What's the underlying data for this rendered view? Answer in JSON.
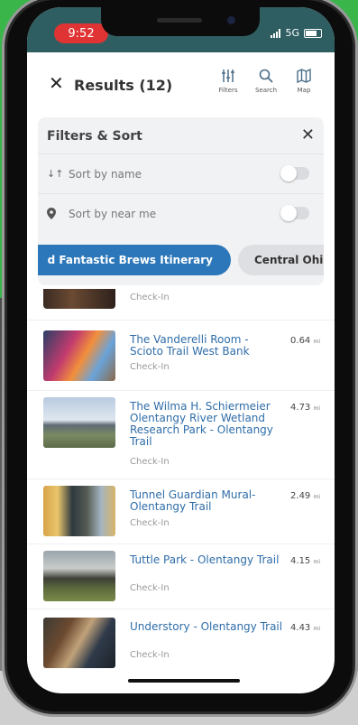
{
  "status_bar": {
    "time": "9:52",
    "network": "5G"
  },
  "header": {
    "close_icon": "close-icon",
    "title": "Results (12)",
    "actions": [
      {
        "label": "Filters",
        "icon": "sliders-icon"
      },
      {
        "label": "Search",
        "icon": "search-icon"
      },
      {
        "label": "Map",
        "icon": "map-icon"
      }
    ]
  },
  "filters": {
    "title": "Filters & Sort",
    "close_icon": "close-icon",
    "sort_options": [
      {
        "label": "Sort by name",
        "icon": "sort-alpha-icon",
        "enabled": false
      },
      {
        "label": "Sort by near me",
        "icon": "location-pin-icon",
        "enabled": false
      }
    ],
    "chips": [
      {
        "label": "d Fantastic Brews Itinerary",
        "selected": true
      },
      {
        "label": "Central Ohio",
        "selected": false
      }
    ]
  },
  "results": {
    "partial_item": {
      "subtitle": "Check-In"
    },
    "items": [
      {
        "title": "The Vanderelli Room - Scioto Trail West Bank",
        "subtitle": "Check-In",
        "distance": "0.64",
        "unit": "mi"
      },
      {
        "title": "The Wilma H. Schiermeier Olentangy River Wetland Research Park - Olentangy Trail",
        "subtitle": "Check-In",
        "distance": "4.73",
        "unit": "mi"
      },
      {
        "title": "Tunnel Guardian Mural-Olentangy Trail",
        "subtitle": "Check-In",
        "distance": "2.49",
        "unit": "mi"
      },
      {
        "title": "Tuttle Park - Olentangy Trail",
        "subtitle": "Check-In",
        "distance": "4.15",
        "unit": "mi"
      },
      {
        "title": "Understory - Olentangy Trail",
        "subtitle": "Check-In",
        "distance": "4.43",
        "unit": "mi"
      }
    ]
  },
  "colors": {
    "status_bar": "#2f5e62",
    "time_pill": "#e03434",
    "accent": "#2c77b9",
    "link": "#2f6da8",
    "chip_inactive": "#dedfe2",
    "filters_panel": "#f1f2f4"
  }
}
